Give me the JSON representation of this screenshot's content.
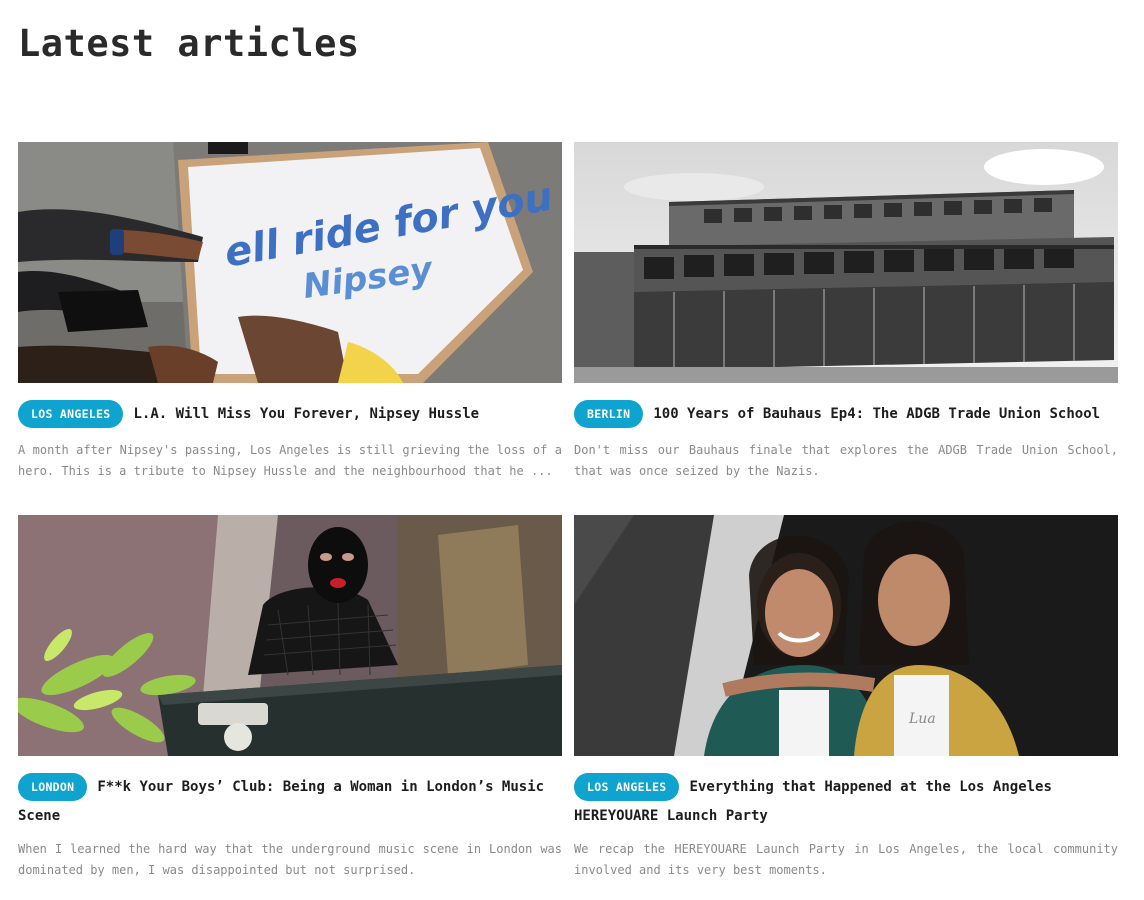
{
  "page": {
    "heading": "Latest articles"
  },
  "articles": [
    {
      "tag": "LOS ANGELES",
      "title": "L.A. Will Miss You Forever, Nipsey Hussle",
      "excerpt": "A month after Nipsey's passing, Los Angeles is still grieving the loss of a hero. This is a tribute to Nipsey Hussle and the neighbourhood that he ...",
      "sign_text": "ell ride for you Nipsey",
      "image": "photo-memorial-sign"
    },
    {
      "tag": "BERLIN",
      "title": "100 Years of Bauhaus Ep4: The ADGB Trade Union School",
      "excerpt": "Don't miss our Bauhaus finale that explores the ADGB Trade Union School, that was once seized by the Nazis.",
      "image": "photo-bauhaus-building"
    },
    {
      "tag": "LONDON",
      "title": "F**k Your Boys’ Club: Being a Woman in London’s Music Scene",
      "excerpt": "When I learned the hard way that the underground music scene in London was dominated by men, I was disappointed but not surprised.",
      "image": "photo-dj-balaclava"
    },
    {
      "tag": "LOS ANGELES",
      "title": "Everything that Happened at the Los Angeles HEREYOUARE Launch Party",
      "excerpt": "We recap the HEREYOUARE Launch Party in Los Angeles, the local community involved and its very best moments.",
      "image": "photo-two-women-party"
    }
  ],
  "colors": {
    "tag_background": "#0fa3cf",
    "tag_text": "#ffffff",
    "excerpt_text": "#8a8a8a"
  }
}
